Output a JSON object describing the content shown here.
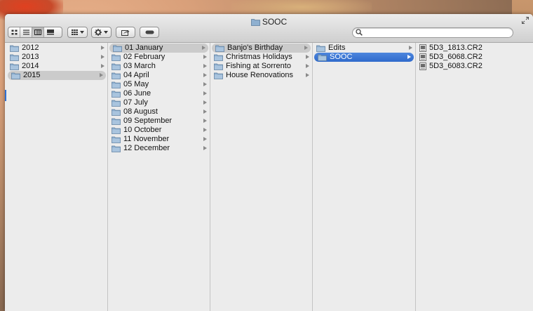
{
  "window": {
    "title": "SOOC"
  },
  "search": {
    "placeholder": "",
    "value": ""
  },
  "columns": [
    {
      "items": [
        {
          "label": "2012",
          "icon": "folder-icon",
          "has_children": true,
          "selected": ""
        },
        {
          "label": "2013",
          "icon": "folder-icon",
          "has_children": true,
          "selected": ""
        },
        {
          "label": "2014",
          "icon": "folder-icon",
          "has_children": true,
          "selected": ""
        },
        {
          "label": "2015",
          "icon": "folder-icon",
          "has_children": true,
          "selected": "grey"
        }
      ]
    },
    {
      "items": [
        {
          "label": "01 January",
          "icon": "folder-icon",
          "has_children": true,
          "selected": "grey"
        },
        {
          "label": "02 February",
          "icon": "folder-icon",
          "has_children": true,
          "selected": ""
        },
        {
          "label": "03 March",
          "icon": "folder-icon",
          "has_children": true,
          "selected": ""
        },
        {
          "label": "04 April",
          "icon": "folder-icon",
          "has_children": true,
          "selected": ""
        },
        {
          "label": "05 May",
          "icon": "folder-icon",
          "has_children": true,
          "selected": ""
        },
        {
          "label": "06 June",
          "icon": "folder-icon",
          "has_children": true,
          "selected": ""
        },
        {
          "label": "07 July",
          "icon": "folder-icon",
          "has_children": true,
          "selected": ""
        },
        {
          "label": "08 August",
          "icon": "folder-icon",
          "has_children": true,
          "selected": ""
        },
        {
          "label": "09 September",
          "icon": "folder-icon",
          "has_children": true,
          "selected": ""
        },
        {
          "label": "10 October",
          "icon": "folder-icon",
          "has_children": true,
          "selected": ""
        },
        {
          "label": "11 November",
          "icon": "folder-icon",
          "has_children": true,
          "selected": ""
        },
        {
          "label": "12 December",
          "icon": "folder-icon",
          "has_children": true,
          "selected": ""
        }
      ]
    },
    {
      "items": [
        {
          "label": "Banjo's Birthday",
          "icon": "folder-icon",
          "has_children": true,
          "selected": "grey"
        },
        {
          "label": "Christmas Holidays",
          "icon": "folder-icon",
          "has_children": true,
          "selected": ""
        },
        {
          "label": "Fishing at Sorrento",
          "icon": "folder-icon",
          "has_children": true,
          "selected": ""
        },
        {
          "label": "House Renovations",
          "icon": "folder-icon",
          "has_children": true,
          "selected": ""
        }
      ]
    },
    {
      "items": [
        {
          "label": "Edits",
          "icon": "folder-icon",
          "has_children": true,
          "selected": ""
        },
        {
          "label": "SOOC",
          "icon": "folder-icon",
          "has_children": true,
          "selected": "blue"
        }
      ]
    },
    {
      "items": [
        {
          "label": "5D3_1813.CR2",
          "icon": "raw-file-icon",
          "has_children": false,
          "selected": ""
        },
        {
          "label": "5D3_6068.CR2",
          "icon": "raw-file-icon",
          "has_children": false,
          "selected": ""
        },
        {
          "label": "5D3_6083.CR2",
          "icon": "raw-file-icon",
          "has_children": false,
          "selected": ""
        }
      ]
    }
  ],
  "colors": {
    "selection_blue": "#2f6acc",
    "selection_grey": "#cbcbcb",
    "folder": "#8fb0d0"
  }
}
